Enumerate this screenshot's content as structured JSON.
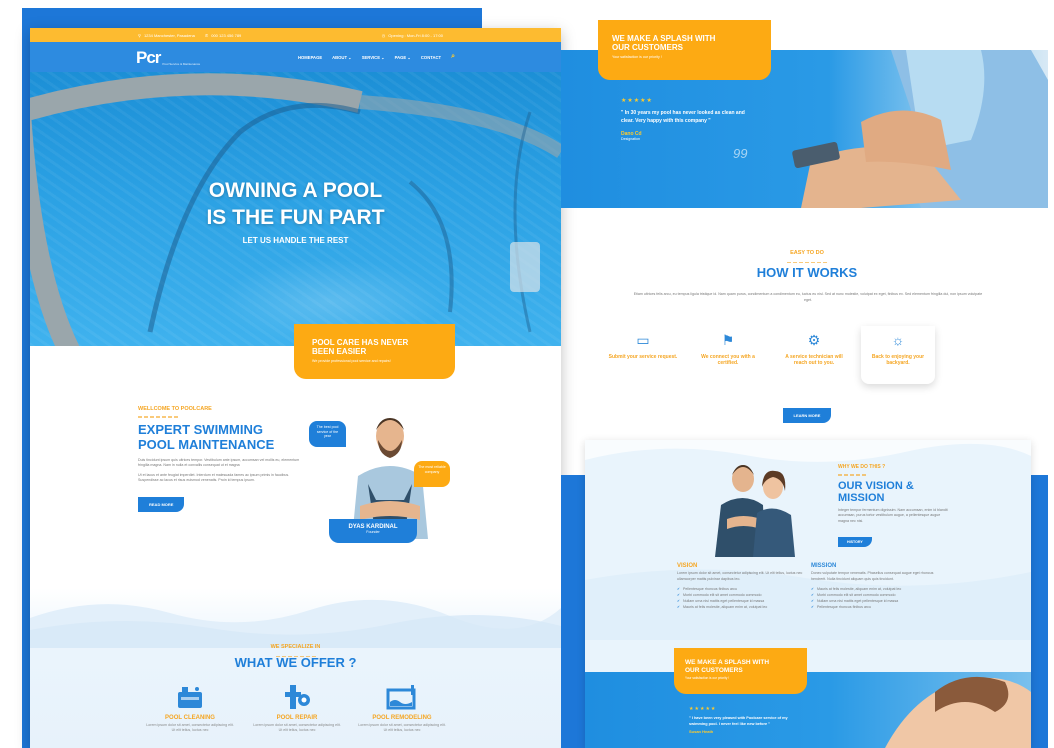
{
  "topbar": {
    "address": "1234 Manchester, Pasadena",
    "phone": "000 123 456 789",
    "hours": "Opening : Mon-Fri 8:00 - 17:00"
  },
  "logo": {
    "mark": "Pcr",
    "tagline": "Pool Service & Maintenance"
  },
  "nav": [
    "HOMEPAGE",
    "ABOUT ⌄",
    "SERVICE ⌄",
    "PAGE ⌄",
    "CONTACT"
  ],
  "hero": {
    "title_line1": "OWNING A POOL",
    "title_line2": "IS THE FUN PART",
    "subtitle": "LET US HANDLE THE REST"
  },
  "promo_left": {
    "title_line1": "POOL CARE HAS NEVER",
    "title_line2": "BEEN EASIER",
    "sub": "We provide professional pool service and repairs!"
  },
  "welcome": {
    "kicker": "WELLCOME TO POOLCARE",
    "title_line1": "EXPERT SWIMMING",
    "title_line2": "POOL MAINTENANCE",
    "p1": "Duis tincidunt ipsum quis ultrices tempor. Vestibulum ante ipsum, accumsan vel mollis eu, elementum fringilla magna. Nam in nulla et convallis consequat ut et magna",
    "p2": "Ut et lacus et ante feugiat imperdiet. Interdum et malesuada fames ac ipsum primis in faucibus. Suspendisse ac lacus et risus euismod venenatis. Proin id tempus ipsum.",
    "button": "READ MORE",
    "bubble1": "The best pool service of the year",
    "bubble2": "The most reliable company",
    "person_name": "DYAS KARDINAL",
    "person_role": "Founder"
  },
  "offer": {
    "kicker": "WE SPECIALIZE IN",
    "title": "WHAT WE OFFER ?",
    "items": [
      {
        "label": "POOL CLEANING",
        "icon": "pool-cleaning-icon",
        "desc": "Lorem ipsum dolor sit amet, consectetur adipiscing elit. Ut elit tellus, luctus nec"
      },
      {
        "label": "POOL REPAIR",
        "icon": "pool-repair-icon",
        "desc": "Lorem ipsum dolor sit amet, consectetur adipiscing elit. Ut elit tellus, luctus nec"
      },
      {
        "label": "POOL REMODELING",
        "icon": "pool-remodeling-icon",
        "desc": "Lorem ipsum dolor sit amet, consectetur adipiscing elit. Ut elit tellus, luctus nec"
      }
    ]
  },
  "testimonial_top": {
    "promo_title_line1": "WE MAKE A SPLASH WITH",
    "promo_title_line2": "OUR CUSTOMERS",
    "promo_sub": "Your satisfaction is our priority !",
    "stars": "★★★★★",
    "quote": "\" In 30 years my pool has never looked as clean and clear. Very happy with this company \"",
    "author": "Dano Cd",
    "author_role": "Designation",
    "quote_mark": "99"
  },
  "how": {
    "kicker": "EASY TO DO",
    "title": "HOW IT WORKS",
    "text": "Etiam ultrices felis arcu, eu tempus ligula tristique id. Nam quam purus, condimentum a condimentum eu, luctus eu nisl. Sed at nunc molestie, volutpat ex eget, finibus ex. Sed elementum fringilla dui, non ipsum volutpate eget.",
    "steps": [
      {
        "icon": "chat-icon",
        "label": "Submit your service request."
      },
      {
        "icon": "handshake-icon",
        "label": "We connect you with a certified."
      },
      {
        "icon": "gear-icon",
        "label": "A service technician will reach out to you."
      },
      {
        "icon": "relax-icon",
        "label": "Back to enjoying your backyard."
      }
    ],
    "button": "LEARN MORE"
  },
  "vision": {
    "kicker": "WHY WE DO THIS ?",
    "title_line1": "OUR VISION &",
    "title_line2": "MISSION",
    "text": "Integer tempor fermentum dignissim. Nam accumsan, enim id blandit accumsan, purus tortor vestibulum augue, a pellentesque augue magna nec nisi.",
    "button": "HISTORY",
    "vision_title": "VISION",
    "vision_text": "Lorem ipsum dolor sit amet, consectetur adipiscing elit. Ut elit tellus, luctus nec ullamcorper mattis pulvinar dapibus leo.",
    "vision_list": [
      "Pellentesque rhoncus finibus arcu",
      "Morbi commodo elit sit amet commodo commodo",
      "Nullam urna nisi mattis eget pellentesque id massa",
      "Mauris at felis molestie, aliquam enim at, volutpat leo"
    ],
    "mission_title": "MISSION",
    "mission_text": "Donec vulputate tempor venenatis. Phasellus consequat augue eget rhoncus hendrerit. Nulla tincidunt aliquam quis quis tincidunt.",
    "mission_list": [
      "Mauris at felis molestie, aliquam enim at, volutpat leo",
      "Morbi commodo elit sit amet commodo commodo",
      "Nullam urna nisi mattis eget pellentesque id massa",
      "Pellentesque rhoncus finibus arcu"
    ]
  },
  "testimonial_bottom": {
    "promo_title_line1": "WE MAKE A SPLASH WITH",
    "promo_title_line2": "OUR CUSTOMERS",
    "promo_sub": "Your satisfaction is our priority !",
    "stars": "★★★★★",
    "quote": "\" I have been very pleased with Poolcare service of my swimming pool. I never feel like new before \"",
    "author": "Susan Heath"
  },
  "colors": {
    "primary": "#1f7fd9",
    "accent": "#fdaa13",
    "topbar": "#fdbb30"
  }
}
